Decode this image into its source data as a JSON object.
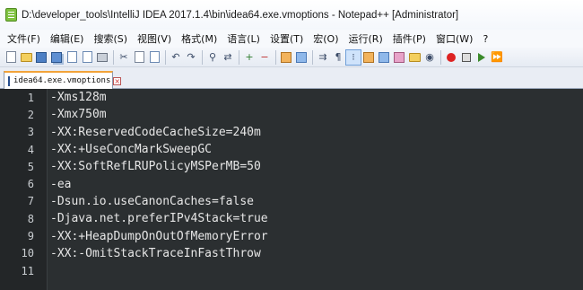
{
  "window": {
    "title": "D:\\developer_tools\\IntelliJ IDEA 2017.1.4\\bin\\idea64.exe.vmoptions - Notepad++ [Administrator]",
    "app_icon": "notepadpp-icon"
  },
  "menu": {
    "items": [
      {
        "label": "文件(F)"
      },
      {
        "label": "编辑(E)"
      },
      {
        "label": "搜索(S)"
      },
      {
        "label": "视图(V)"
      },
      {
        "label": "格式(M)"
      },
      {
        "label": "语言(L)"
      },
      {
        "label": "设置(T)"
      },
      {
        "label": "宏(O)"
      },
      {
        "label": "运行(R)"
      },
      {
        "label": "插件(P)"
      },
      {
        "label": "窗口(W)"
      },
      {
        "label": "?"
      }
    ]
  },
  "toolbar": {
    "icons": [
      "new-file-icon",
      "open-folder-icon",
      "save-icon",
      "save-all-icon",
      "close-icon",
      "close-all-icon",
      "print-icon",
      "cut-icon",
      "copy-icon",
      "paste-icon",
      "undo-icon",
      "redo-icon",
      "find-icon",
      "replace-icon",
      "zoom-in-icon",
      "zoom-out-icon",
      "sync-vertical-icon",
      "sync-horizontal-icon",
      "word-wrap-icon",
      "show-all-chars-icon",
      "indent-guide-icon",
      "user-language-icon",
      "function-list-icon",
      "folder-workspace-icon",
      "doc-map-icon",
      "monitoring-icon",
      "record-macro-icon",
      "stop-record-icon",
      "playback-icon",
      "run-macro-multiple-icon"
    ]
  },
  "tabs": [
    {
      "label": "idea64.exe.vmoptions",
      "active": true
    }
  ],
  "editor": {
    "lines": [
      {
        "num": "1",
        "text": "-Xms128m"
      },
      {
        "num": "2",
        "text": "-Xmx750m"
      },
      {
        "num": "3",
        "text": "-XX:ReservedCodeCacheSize=240m"
      },
      {
        "num": "4",
        "text": "-XX:+UseConcMarkSweepGC"
      },
      {
        "num": "5",
        "text": "-XX:SoftRefLRUPolicyMSPerMB=50"
      },
      {
        "num": "6",
        "text": "-ea"
      },
      {
        "num": "7",
        "text": "-Dsun.io.useCanonCaches=false"
      },
      {
        "num": "8",
        "text": "-Djava.net.preferIPv4Stack=true"
      },
      {
        "num": "9",
        "text": "-XX:+HeapDumpOnOutOfMemoryError"
      },
      {
        "num": "10",
        "text": "-XX:-OmitStackTraceInFastThrow"
      },
      {
        "num": "11",
        "text": ""
      }
    ]
  },
  "colors": {
    "editor_bg": "#2b2f31",
    "gutter_bg": "#232628",
    "text": "#e6e6e6",
    "tab_accent": "#f2a33a"
  }
}
